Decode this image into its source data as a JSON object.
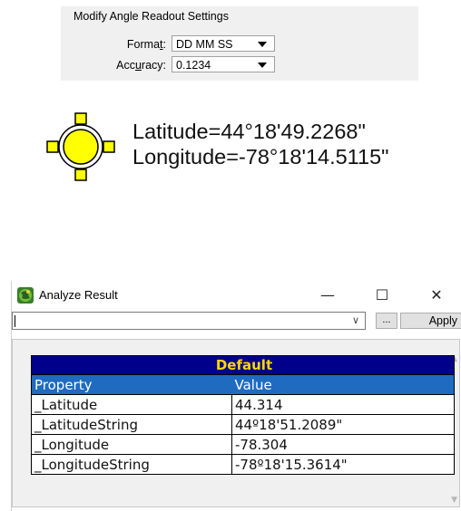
{
  "settings": {
    "title": "Modify Angle Readout Settings",
    "format_label_pre": "Forma",
    "format_label_u": "t",
    "format_label_post": ":",
    "format_value": "DD MM SS",
    "accuracy_label_pre": "Acc",
    "accuracy_label_u": "u",
    "accuracy_label_post": "racy:",
    "accuracy_value": "0.1234"
  },
  "readout": {
    "symbol": "crosshair-marker-icon",
    "latitude": "Latitude=44°18'49.2268\"",
    "longitude": "Longitude=-78°18'14.5115\""
  },
  "window": {
    "title": "Analyze Result",
    "minimize": "—",
    "maximize": "☐",
    "close": "✕",
    "combo_value": "",
    "browse_label": "...",
    "apply_label": "Apply",
    "table": {
      "group": "Default",
      "headers": [
        "Property",
        "Value"
      ],
      "rows": [
        [
          "_Latitude",
          "44.314"
        ],
        [
          "_LatitudeString",
          "44º18'51.2089\""
        ],
        [
          "_Longitude",
          "-78.304"
        ],
        [
          "_LongitudeString",
          "-78º18'15.3614\""
        ]
      ]
    }
  },
  "colors": {
    "panel_bg": "#f0f0f0",
    "group_bg": "#00008b",
    "group_text": "#ffd700",
    "header_bg": "#1e6bc0",
    "marker_fill": "#ffff00"
  }
}
